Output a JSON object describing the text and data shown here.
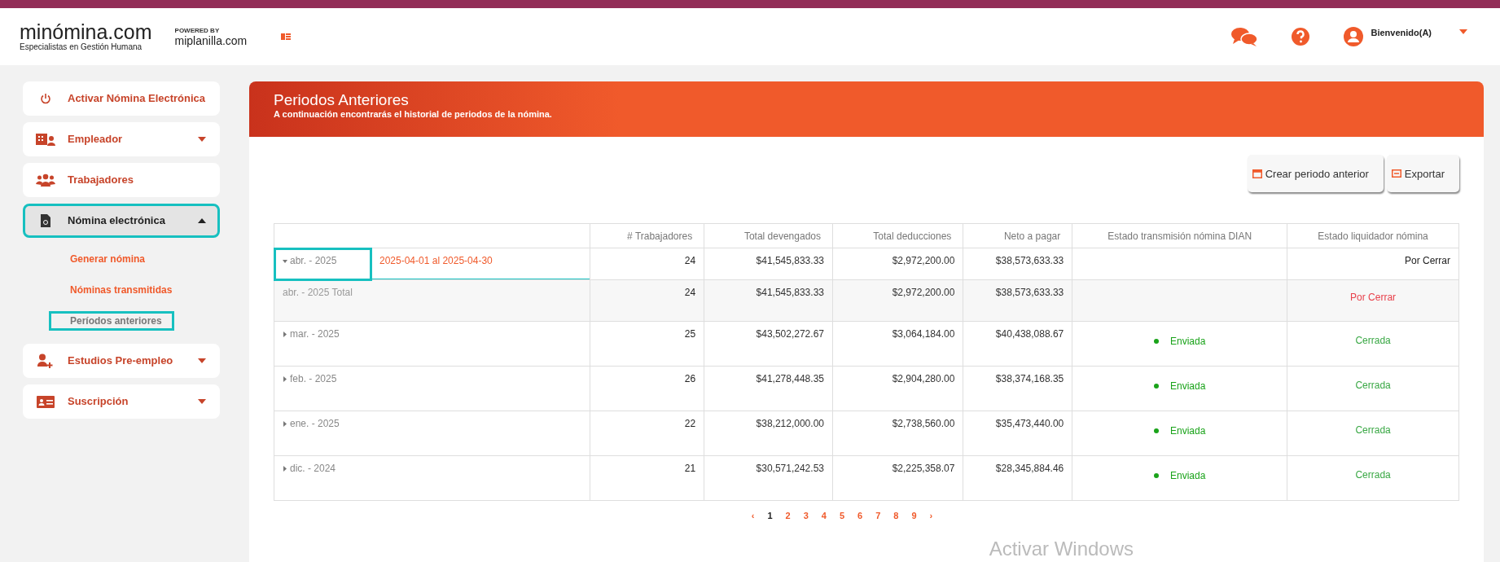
{
  "header": {
    "logo_text": "minómina.com",
    "logo_tagline": "Especialistas en Gestión Humana",
    "powered_by": "POWERED BY",
    "partner": "miplanilla.com",
    "welcome": "Bienvenido(A)"
  },
  "sidebar": {
    "items": [
      {
        "label": "Activar Nómina Electrónica",
        "selected": false,
        "highlighted": false
      },
      {
        "label": "Empleador",
        "expanded": false,
        "selected": false,
        "highlighted": false
      },
      {
        "label": "Trabajadores",
        "selected": false,
        "highlighted": false
      },
      {
        "label": "Nómina electrónica",
        "expanded": true,
        "selected": true,
        "highlighted": true,
        "children": [
          {
            "label": "Generar nómina",
            "selected": false,
            "highlighted": false
          },
          {
            "label": "Nóminas transmitidas",
            "selected": false,
            "highlighted": false
          },
          {
            "label": "Períodos anteriores",
            "selected": true,
            "highlighted": true
          }
        ]
      },
      {
        "label": "Estudios Pre-empleo",
        "expanded": false,
        "selected": false,
        "highlighted": false
      },
      {
        "label": "Suscripción",
        "expanded": false,
        "selected": false,
        "highlighted": false
      }
    ]
  },
  "banner": {
    "title": "Periodos Anteriores",
    "subtitle": "A continuación encontrarás el historial de periodos de la nómina."
  },
  "buttons": [
    {
      "label": "Crear periodo anterior"
    },
    {
      "label": "Exportar"
    }
  ],
  "table": {
    "columns": [
      "# Trabajadores",
      "Total devengados",
      "Total deducciones",
      "Neto a pagar",
      "Estado transmisión nómina DIAN",
      "Estado liquidador nómina"
    ],
    "rows": [
      {
        "kind": "period",
        "period": "abr. - 2025",
        "expanded": true,
        "highlighted": true,
        "range": "2025-04-01 al 2025-04-30",
        "workers": "24",
        "earned": "$41,545,833.33",
        "deductions": "$2,972,200.00",
        "net": "$38,573,633.33",
        "dian": null,
        "status": {
          "text": "Por Cerrar",
          "color": "#222222"
        }
      },
      {
        "kind": "total",
        "period": "abr. - 2025 Total",
        "workers": "24",
        "earned": "$41,545,833.33",
        "deductions": "$2,972,200.00",
        "net": "$38,573,633.33",
        "dian": null,
        "status": {
          "text": "Por Cerrar",
          "color": "#e8414b"
        }
      },
      {
        "kind": "period",
        "period": "mar. - 2025",
        "expanded": false,
        "highlighted": false,
        "workers": "25",
        "earned": "$43,502,272.67",
        "deductions": "$3,064,184.00",
        "net": "$40,438,088.67",
        "dian": {
          "text": "Enviada",
          "color": "#1aa31a"
        },
        "status": {
          "text": "Cerrada",
          "color": "#3aa845"
        }
      },
      {
        "kind": "period",
        "period": "feb. - 2025",
        "expanded": false,
        "highlighted": false,
        "workers": "26",
        "earned": "$41,278,448.35",
        "deductions": "$2,904,280.00",
        "net": "$38,374,168.35",
        "dian": {
          "text": "Enviada",
          "color": "#1aa31a"
        },
        "status": {
          "text": "Cerrada",
          "color": "#3aa845"
        }
      },
      {
        "kind": "period",
        "period": "ene. - 2025",
        "expanded": false,
        "highlighted": false,
        "workers": "22",
        "earned": "$38,212,000.00",
        "deductions": "$2,738,560.00",
        "net": "$35,473,440.00",
        "dian": {
          "text": "Enviada",
          "color": "#1aa31a"
        },
        "status": {
          "text": "Cerrada",
          "color": "#3aa845"
        }
      },
      {
        "kind": "period",
        "period": "dic. - 2024",
        "expanded": false,
        "highlighted": false,
        "workers": "21",
        "earned": "$30,571,242.53",
        "deductions": "$2,225,358.07",
        "net": "$28,345,884.46",
        "dian": {
          "text": "Enviada",
          "color": "#1aa31a"
        },
        "status": {
          "text": "Cerrada",
          "color": "#3aa845"
        }
      }
    ]
  },
  "pagination": {
    "prev": "‹",
    "next": "›",
    "pages": [
      {
        "label": "1",
        "selected": true
      },
      {
        "label": "2",
        "selected": false
      },
      {
        "label": "3",
        "selected": false
      },
      {
        "label": "4",
        "selected": false
      },
      {
        "label": "5",
        "selected": false
      },
      {
        "label": "6",
        "selected": false
      },
      {
        "label": "7",
        "selected": false
      },
      {
        "label": "8",
        "selected": false
      },
      {
        "label": "9",
        "selected": false
      }
    ]
  },
  "os_notice": "Activar Windows"
}
